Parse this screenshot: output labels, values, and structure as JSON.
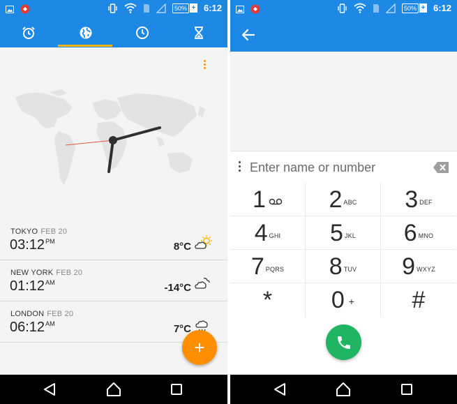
{
  "status_bar": {
    "battery": "50%",
    "time": "6:12"
  },
  "world_clock": {
    "tabs": [
      {
        "icon": "alarm-icon"
      },
      {
        "icon": "globe-icon",
        "selected": true
      },
      {
        "icon": "clock-icon"
      },
      {
        "icon": "hourglass-icon"
      }
    ],
    "cities": [
      {
        "name": "TOKYO",
        "date": "FEB 20",
        "time": "03:12",
        "period": "PM",
        "temp": "8°C",
        "weather": "partly-sunny-icon"
      },
      {
        "name": "NEW YORK",
        "date": "FEB 20",
        "time": "01:12",
        "period": "AM",
        "temp": "-14°C",
        "weather": "cloudy-night-icon"
      },
      {
        "name": "LONDON",
        "date": "FEB 20",
        "time": "06:12",
        "period": "AM",
        "temp": "7°C",
        "weather": "rain-icon"
      }
    ],
    "add_button": "+"
  },
  "dialer": {
    "placeholder": "Enter name or number",
    "keys": [
      {
        "digit": "1",
        "sub": ""
      },
      {
        "digit": "2",
        "sub": "ABC"
      },
      {
        "digit": "3",
        "sub": "DEF"
      },
      {
        "digit": "4",
        "sub": "GHI"
      },
      {
        "digit": "5",
        "sub": "JKL"
      },
      {
        "digit": "6",
        "sub": "MNO"
      },
      {
        "digit": "7",
        "sub": "PQRS"
      },
      {
        "digit": "8",
        "sub": "TUV"
      },
      {
        "digit": "9",
        "sub": "WXYZ"
      },
      {
        "digit": "*",
        "sub": ""
      },
      {
        "digit": "0",
        "sub": "+"
      },
      {
        "digit": "#",
        "sub": ""
      }
    ]
  },
  "colors": {
    "primary": "#1e88e5",
    "accent_orange": "#ff8f00",
    "call_green": "#20b463"
  }
}
